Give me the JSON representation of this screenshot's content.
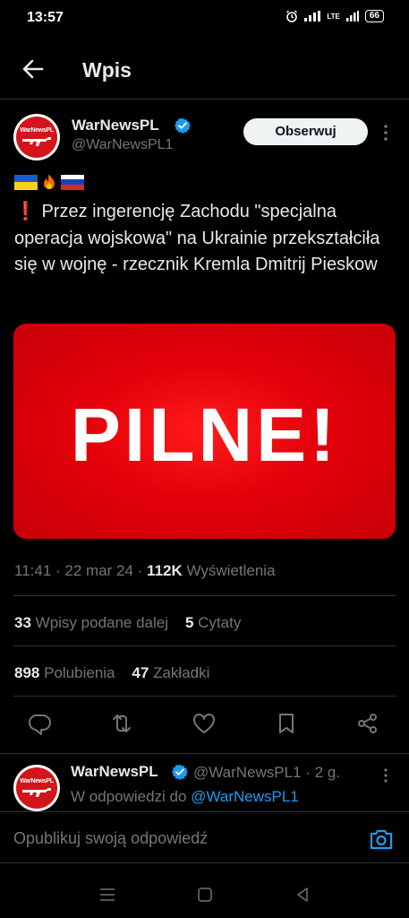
{
  "status_bar": {
    "time": "13:57",
    "network": "LTE",
    "battery": "66"
  },
  "header": {
    "title": "Wpis",
    "back_icon": "arrow-left-icon"
  },
  "tweet": {
    "author": {
      "name": "WarNewsPL",
      "handle": "@WarNewsPL1",
      "avatar_text": "WarNewsPL",
      "verified": true
    },
    "follow_label": "Obserwuj",
    "emoji_flags": [
      "ukraine-flag",
      "fire",
      "russia-flag"
    ],
    "bang": "❗",
    "text": "Przez ingerencję Zachodu \"specjalna operacja wojskowa\" na Ukrainie przekształciła się w wojnę - rzecznik Kremla Dmitrij Pieskow",
    "media_text": "PILNE!",
    "time": "11:41",
    "date": "22 mar 24",
    "views_count": "112K",
    "views_label": "Wyświetlenia",
    "retweets_count": "33",
    "retweets_label": "Wpisy podane dalej",
    "quotes_count": "5",
    "quotes_label": "Cytaty",
    "likes_count": "898",
    "likes_label": "Polubienia",
    "bookmarks_count": "47",
    "bookmarks_label": "Zakładki"
  },
  "actions": [
    "reply-icon",
    "retweet-icon",
    "like-icon",
    "bookmark-icon",
    "share-icon"
  ],
  "reply": {
    "name": "WarNewsPL",
    "handle": "@WarNewsPL1 · 2 g.",
    "reply_to_prefix": "W odpowiedzi do",
    "reply_to_handle": "@WarNewsPL1"
  },
  "compose": {
    "placeholder": "Opublikuj swoją odpowiedź"
  },
  "colors": {
    "background": "#000000",
    "text": "#e7e9ea",
    "muted": "#71767b",
    "accent": "#1d9bf0",
    "media_red": "#e3000a"
  }
}
